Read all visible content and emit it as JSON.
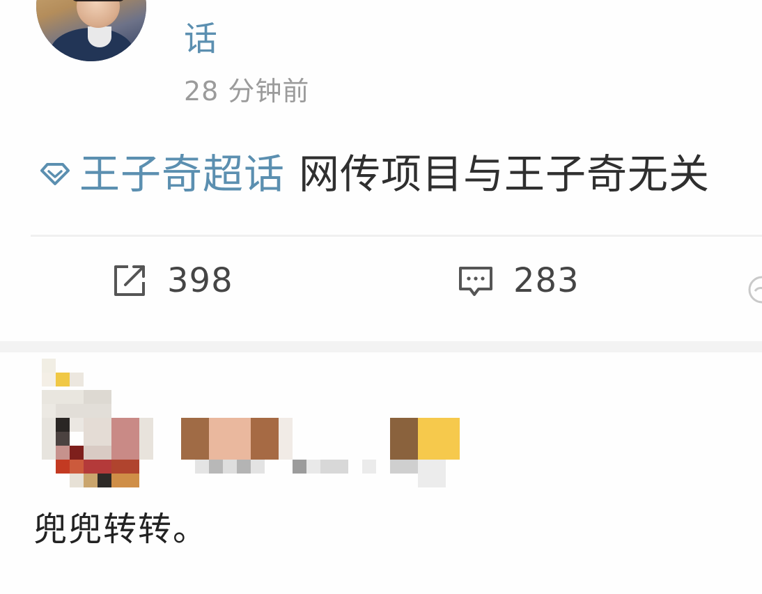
{
  "post": {
    "author_name_visible": "话",
    "timestamp": "28 分钟前",
    "topic": "王子奇超话",
    "text": "网传项目与王子奇无关",
    "topic_icon": "super-topic-diamond-icon",
    "accent_color": "#5b8fb0"
  },
  "actions": {
    "repost": {
      "icon": "repost-icon",
      "count": "398"
    },
    "comment": {
      "icon": "comment-icon",
      "count": "283"
    },
    "like": {
      "icon": "like-icon"
    }
  },
  "repost_item": {
    "user_info": "pixelated-censored",
    "text": "兜兜转转。"
  }
}
